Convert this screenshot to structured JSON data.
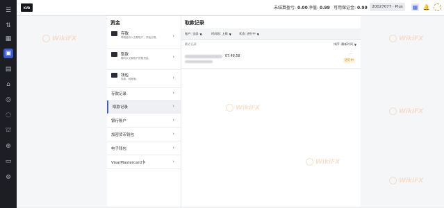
{
  "topbar": {
    "logo_text": "KVB",
    "unrealized_label": "未结算盈亏:",
    "unrealized_value": "0.00",
    "equity_label": "净值:",
    "equity_value": "0.99",
    "free_margin_label": "可用保证金:",
    "free_margin_value": "0.99",
    "account": "20027077 · Plus"
  },
  "rail": {
    "icons": [
      "menu-icon",
      "market-icon",
      "grid-icon",
      "wallet-icon",
      "calendar-icon",
      "gift-icon",
      "globe-icon",
      "chat-icon",
      "bank-icon",
      "download-icon",
      "book-icon",
      "settings-icon"
    ],
    "active_index": 3
  },
  "menu": {
    "title": "资金",
    "actions": [
      {
        "title": "存款",
        "desc": "简易金存入交易账户，开始交易。",
        "icon": "deposit-icon"
      },
      {
        "title": "取款",
        "desc": "随时从交易账户提取资金。",
        "icon": "withdraw-icon"
      },
      {
        "title": "钱包",
        "desc": "存款、转账等。",
        "icon": "wallet-icon"
      }
    ],
    "items": [
      {
        "label": "存款记录",
        "active": false
      },
      {
        "label": "取款记录",
        "active": true
      },
      {
        "label": "银行账户",
        "active": false
      },
      {
        "label": "加密货币钱包",
        "active": false
      },
      {
        "label": "电子钱包",
        "active": false
      },
      {
        "label": "Visa/Mastercard卡",
        "active": false
      }
    ]
  },
  "content": {
    "title": "取款记录",
    "filters": [
      {
        "label": "账户: 全部"
      },
      {
        "label": "时间段: 上周"
      },
      {
        "label": "状态: 进行中"
      }
    ],
    "col_left": "最近记录",
    "col_right": "排序: 最新时间",
    "records": [
      {
        "time": "07:48:58",
        "status": "进行中",
        "menu": "···"
      }
    ]
  },
  "watermark": "WikiFX",
  "colors": {
    "accent": "#3c5bd6",
    "status_pending": "#e08a00",
    "rail_bg": "#1c1e24"
  }
}
